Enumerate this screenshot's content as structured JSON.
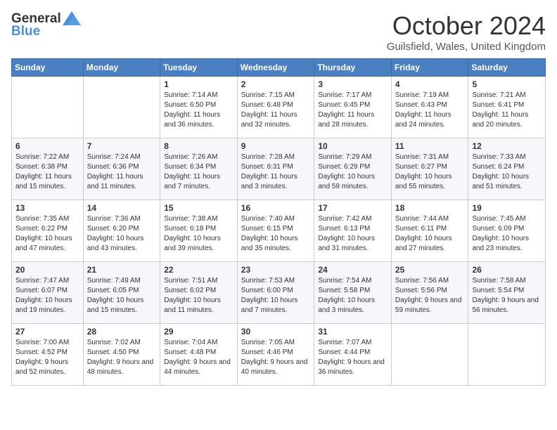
{
  "header": {
    "logo_general": "General",
    "logo_blue": "Blue",
    "month_title": "October 2024",
    "location": "Guilsfield, Wales, United Kingdom"
  },
  "days_of_week": [
    "Sunday",
    "Monday",
    "Tuesday",
    "Wednesday",
    "Thursday",
    "Friday",
    "Saturday"
  ],
  "weeks": [
    [
      {
        "day": "",
        "sunrise": "",
        "sunset": "",
        "daylight": ""
      },
      {
        "day": "",
        "sunrise": "",
        "sunset": "",
        "daylight": ""
      },
      {
        "day": "1",
        "sunrise": "Sunrise: 7:14 AM",
        "sunset": "Sunset: 6:50 PM",
        "daylight": "Daylight: 11 hours and 36 minutes."
      },
      {
        "day": "2",
        "sunrise": "Sunrise: 7:15 AM",
        "sunset": "Sunset: 6:48 PM",
        "daylight": "Daylight: 11 hours and 32 minutes."
      },
      {
        "day": "3",
        "sunrise": "Sunrise: 7:17 AM",
        "sunset": "Sunset: 6:45 PM",
        "daylight": "Daylight: 11 hours and 28 minutes."
      },
      {
        "day": "4",
        "sunrise": "Sunrise: 7:19 AM",
        "sunset": "Sunset: 6:43 PM",
        "daylight": "Daylight: 11 hours and 24 minutes."
      },
      {
        "day": "5",
        "sunrise": "Sunrise: 7:21 AM",
        "sunset": "Sunset: 6:41 PM",
        "daylight": "Daylight: 11 hours and 20 minutes."
      }
    ],
    [
      {
        "day": "6",
        "sunrise": "Sunrise: 7:22 AM",
        "sunset": "Sunset: 6:38 PM",
        "daylight": "Daylight: 11 hours and 15 minutes."
      },
      {
        "day": "7",
        "sunrise": "Sunrise: 7:24 AM",
        "sunset": "Sunset: 6:36 PM",
        "daylight": "Daylight: 11 hours and 11 minutes."
      },
      {
        "day": "8",
        "sunrise": "Sunrise: 7:26 AM",
        "sunset": "Sunset: 6:34 PM",
        "daylight": "Daylight: 11 hours and 7 minutes."
      },
      {
        "day": "9",
        "sunrise": "Sunrise: 7:28 AM",
        "sunset": "Sunset: 6:31 PM",
        "daylight": "Daylight: 11 hours and 3 minutes."
      },
      {
        "day": "10",
        "sunrise": "Sunrise: 7:29 AM",
        "sunset": "Sunset: 6:29 PM",
        "daylight": "Daylight: 10 hours and 59 minutes."
      },
      {
        "day": "11",
        "sunrise": "Sunrise: 7:31 AM",
        "sunset": "Sunset: 6:27 PM",
        "daylight": "Daylight: 10 hours and 55 minutes."
      },
      {
        "day": "12",
        "sunrise": "Sunrise: 7:33 AM",
        "sunset": "Sunset: 6:24 PM",
        "daylight": "Daylight: 10 hours and 51 minutes."
      }
    ],
    [
      {
        "day": "13",
        "sunrise": "Sunrise: 7:35 AM",
        "sunset": "Sunset: 6:22 PM",
        "daylight": "Daylight: 10 hours and 47 minutes."
      },
      {
        "day": "14",
        "sunrise": "Sunrise: 7:36 AM",
        "sunset": "Sunset: 6:20 PM",
        "daylight": "Daylight: 10 hours and 43 minutes."
      },
      {
        "day": "15",
        "sunrise": "Sunrise: 7:38 AM",
        "sunset": "Sunset: 6:18 PM",
        "daylight": "Daylight: 10 hours and 39 minutes."
      },
      {
        "day": "16",
        "sunrise": "Sunrise: 7:40 AM",
        "sunset": "Sunset: 6:15 PM",
        "daylight": "Daylight: 10 hours and 35 minutes."
      },
      {
        "day": "17",
        "sunrise": "Sunrise: 7:42 AM",
        "sunset": "Sunset: 6:13 PM",
        "daylight": "Daylight: 10 hours and 31 minutes."
      },
      {
        "day": "18",
        "sunrise": "Sunrise: 7:44 AM",
        "sunset": "Sunset: 6:11 PM",
        "daylight": "Daylight: 10 hours and 27 minutes."
      },
      {
        "day": "19",
        "sunrise": "Sunrise: 7:45 AM",
        "sunset": "Sunset: 6:09 PM",
        "daylight": "Daylight: 10 hours and 23 minutes."
      }
    ],
    [
      {
        "day": "20",
        "sunrise": "Sunrise: 7:47 AM",
        "sunset": "Sunset: 6:07 PM",
        "daylight": "Daylight: 10 hours and 19 minutes."
      },
      {
        "day": "21",
        "sunrise": "Sunrise: 7:49 AM",
        "sunset": "Sunset: 6:05 PM",
        "daylight": "Daylight: 10 hours and 15 minutes."
      },
      {
        "day": "22",
        "sunrise": "Sunrise: 7:51 AM",
        "sunset": "Sunset: 6:02 PM",
        "daylight": "Daylight: 10 hours and 11 minutes."
      },
      {
        "day": "23",
        "sunrise": "Sunrise: 7:53 AM",
        "sunset": "Sunset: 6:00 PM",
        "daylight": "Daylight: 10 hours and 7 minutes."
      },
      {
        "day": "24",
        "sunrise": "Sunrise: 7:54 AM",
        "sunset": "Sunset: 5:58 PM",
        "daylight": "Daylight: 10 hours and 3 minutes."
      },
      {
        "day": "25",
        "sunrise": "Sunrise: 7:56 AM",
        "sunset": "Sunset: 5:56 PM",
        "daylight": "Daylight: 9 hours and 59 minutes."
      },
      {
        "day": "26",
        "sunrise": "Sunrise: 7:58 AM",
        "sunset": "Sunset: 5:54 PM",
        "daylight": "Daylight: 9 hours and 56 minutes."
      }
    ],
    [
      {
        "day": "27",
        "sunrise": "Sunrise: 7:00 AM",
        "sunset": "Sunset: 4:52 PM",
        "daylight": "Daylight: 9 hours and 52 minutes."
      },
      {
        "day": "28",
        "sunrise": "Sunrise: 7:02 AM",
        "sunset": "Sunset: 4:50 PM",
        "daylight": "Daylight: 9 hours and 48 minutes."
      },
      {
        "day": "29",
        "sunrise": "Sunrise: 7:04 AM",
        "sunset": "Sunset: 4:48 PM",
        "daylight": "Daylight: 9 hours and 44 minutes."
      },
      {
        "day": "30",
        "sunrise": "Sunrise: 7:05 AM",
        "sunset": "Sunset: 4:46 PM",
        "daylight": "Daylight: 9 hours and 40 minutes."
      },
      {
        "day": "31",
        "sunrise": "Sunrise: 7:07 AM",
        "sunset": "Sunset: 4:44 PM",
        "daylight": "Daylight: 9 hours and 36 minutes."
      },
      {
        "day": "",
        "sunrise": "",
        "sunset": "",
        "daylight": ""
      },
      {
        "day": "",
        "sunrise": "",
        "sunset": "",
        "daylight": ""
      }
    ]
  ]
}
